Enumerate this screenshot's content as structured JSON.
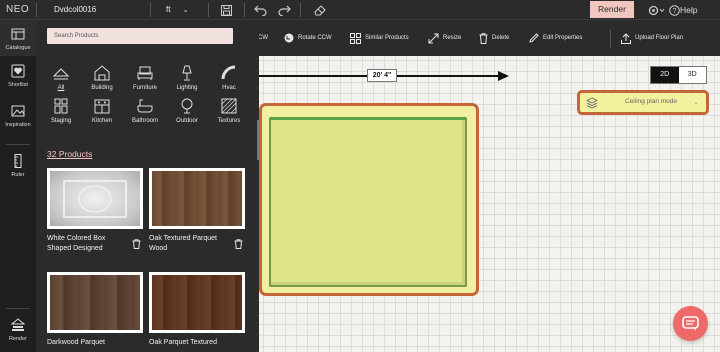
{
  "topbar": {
    "logo": "NEO",
    "project_name": "Dvdcol0016",
    "unit": "ft",
    "render_label": "Render",
    "help_label": "Help"
  },
  "toolbar": {
    "rotate_ccw_partial": "CW",
    "rotate_ccw": "Rotate CCW",
    "similar_products": "Similar Products",
    "resize": "Resize",
    "delete": "Delete",
    "edit_properties": "Edit Properties",
    "upload_floor_plan": "Upload Floor Plan"
  },
  "rail": {
    "catalogue": "Catalogue",
    "shortlist": "Shortlist",
    "inspiration": "Inspiration",
    "ruler": "Ruler",
    "render": "Render"
  },
  "panel": {
    "search_placeholder": "Search Products",
    "categories": [
      {
        "label": "All",
        "icon": "all-icon"
      },
      {
        "label": "Building",
        "icon": "building-icon"
      },
      {
        "label": "Furniture",
        "icon": "furniture-icon"
      },
      {
        "label": "Lighting",
        "icon": "lighting-icon"
      },
      {
        "label": "Hvac",
        "icon": "hvac-icon"
      },
      {
        "label": "Staging",
        "icon": "staging-icon"
      },
      {
        "label": "Kitchen",
        "icon": "kitchen-icon"
      },
      {
        "label": "Bathroom",
        "icon": "bathroom-icon"
      },
      {
        "label": "Outdoor",
        "icon": "outdoor-icon"
      },
      {
        "label": "Textures",
        "icon": "textures-icon"
      }
    ],
    "products_count": "32 Products",
    "products": [
      {
        "name": "White Colored Box Shaped Designed",
        "swatch": "#d8d8d8"
      },
      {
        "name": "Oak Textured Parquet Wood",
        "swatch": "#6b4a33"
      },
      {
        "name": "Darkwood Parquet",
        "swatch": "#5a4030"
      },
      {
        "name": "Oak Parquet Textured",
        "swatch": "#5b3320"
      }
    ]
  },
  "canvas": {
    "dimension_label": "20' 4\"",
    "view_2d": "2D",
    "view_3d": "3D",
    "active_view": "2D",
    "ceiling_mode": "Ceiling plan mode"
  },
  "colors": {
    "accent": "#f2c6c0",
    "highlight_border": "#c4663a",
    "room_fill": "#dde48a",
    "chat_button": "#f0696a"
  }
}
